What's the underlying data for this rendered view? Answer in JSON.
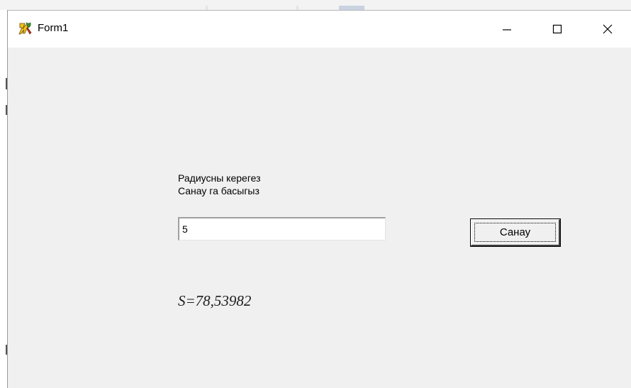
{
  "window": {
    "title": "Form1",
    "icon": "delphi-app-icon",
    "controls": {
      "minimize": "minimize-icon",
      "maximize": "maximize-icon",
      "close": "close-icon"
    }
  },
  "form": {
    "label_line1": "Радиусны керегез",
    "label_line2": "Санау га басыгыз",
    "radius_value": "5",
    "calc_button_label": "Санау",
    "result_text": "S=78,53982"
  },
  "colors": {
    "client_background": "#f0f0f0",
    "titlebar_background": "#ffffff"
  }
}
